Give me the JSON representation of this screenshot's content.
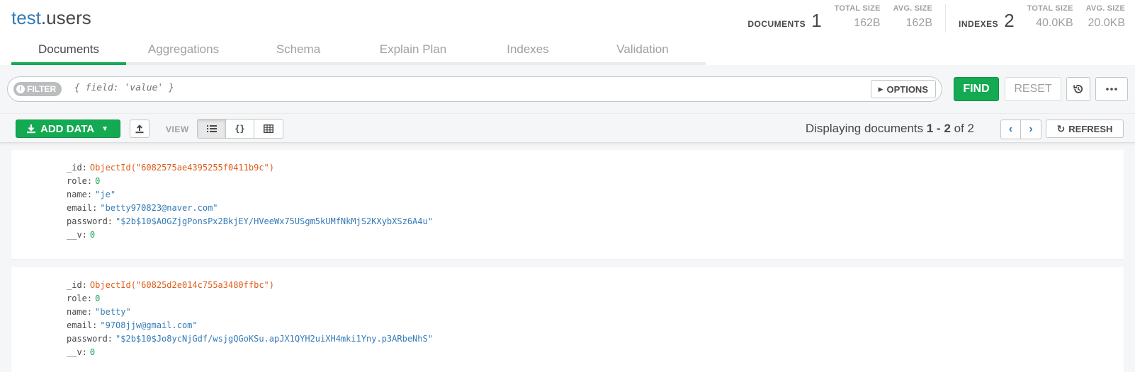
{
  "header": {
    "db": "test",
    "collection": ".users",
    "documents": {
      "label": "DOCUMENTS",
      "count": "1",
      "total_size_label": "TOTAL SIZE",
      "total_size": "162B",
      "avg_size_label": "AVG. SIZE",
      "avg_size": "162B"
    },
    "indexes": {
      "label": "INDEXES",
      "count": "2",
      "total_size_label": "TOTAL SIZE",
      "total_size": "40.0KB",
      "avg_size_label": "AVG. SIZE",
      "avg_size": "20.0KB"
    }
  },
  "tabs": [
    {
      "label": "Documents",
      "active": true
    },
    {
      "label": "Aggregations",
      "active": false
    },
    {
      "label": "Schema",
      "active": false
    },
    {
      "label": "Explain Plan",
      "active": false
    },
    {
      "label": "Indexes",
      "active": false
    },
    {
      "label": "Validation",
      "active": false
    }
  ],
  "querybar": {
    "filter_label": "FILTER",
    "filter_placeholder": "{ field: 'value' }",
    "options_label": "OPTIONS",
    "find_label": "FIND",
    "reset_label": "RESET"
  },
  "controls": {
    "add_data_label": "ADD DATA",
    "view_label": "VIEW",
    "displaying_prefix": "Displaying documents ",
    "range_start": "1",
    "range_sep": " - ",
    "range_end": "2",
    "of_text": " of 2",
    "refresh_label": "REFRESH"
  },
  "documents": [
    {
      "_id": "ObjectId(\"6082575ae4395255f0411b9c\")",
      "role": "0",
      "name": "\"je\"",
      "email": "\"betty970823@naver.com\"",
      "password": "\"$2b$10$A0GZjgPonsPx2BkjEY/HVeeWx75USgm5kUMfNkMjS2KXybXSz6A4u\"",
      "__v": "0"
    },
    {
      "_id": "ObjectId(\"60825d2e014c755a3480ffbc\")",
      "role": "0",
      "name": "\"betty\"",
      "email": "\"9708jjw@gmail.com\"",
      "password": "\"$2b$10$Jo8ycNjGdf/wsjgQGoKSu.apJX1QYH2uiXH4mki1Yny.p3ARbeNhS\"",
      "__v": "0"
    }
  ],
  "field_keys": {
    "id": "_id",
    "role": "role",
    "name": "name",
    "email": "email",
    "password": "password",
    "v": "__v",
    "colon": ":"
  },
  "colors": {
    "accent": "#13aa52",
    "link": "#337ab7",
    "objectid": "#de5c19"
  }
}
